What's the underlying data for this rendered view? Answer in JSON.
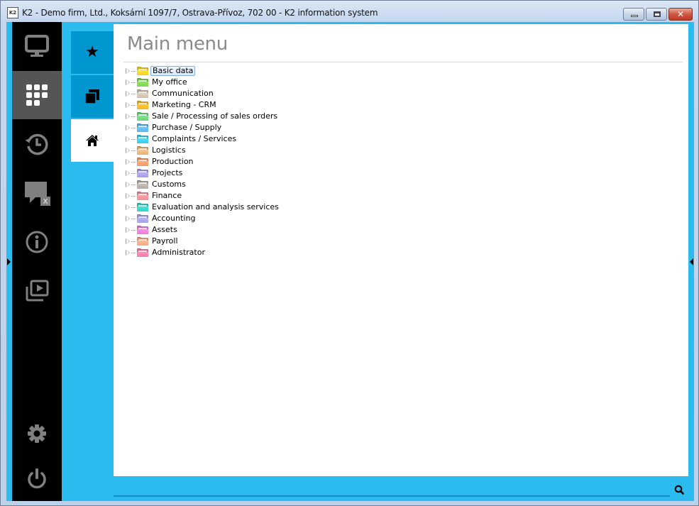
{
  "window": {
    "title": "K2 - Demo firm, Ltd., Koksární 1097/7, Ostrava-Přívoz, 702 00 - K2 information system",
    "app_icon_text": "K2",
    "controls": {
      "minimize": "minimize",
      "maximize": "maximize",
      "close": "✕"
    }
  },
  "left_bar": {
    "items": [
      {
        "name": "desktop",
        "icon": "monitor-icon",
        "active": false
      },
      {
        "name": "main-menu",
        "icon": "grid-icon",
        "active": true
      },
      {
        "name": "history",
        "icon": "history-icon",
        "active": false
      },
      {
        "name": "messages",
        "icon": "chat-icon",
        "badge": "X",
        "active": false
      },
      {
        "name": "info",
        "icon": "info-icon",
        "active": false
      },
      {
        "name": "media",
        "icon": "video-library-icon",
        "active": false
      },
      {
        "name": "settings",
        "icon": "gear-icon",
        "active": false
      },
      {
        "name": "logout",
        "icon": "power-icon",
        "active": false
      }
    ],
    "chat_badge": "X"
  },
  "tabs": [
    {
      "name": "favorites",
      "icon": "star-icon",
      "glyph": "★",
      "active": false
    },
    {
      "name": "windows",
      "icon": "windows-icon",
      "active": false
    },
    {
      "name": "home",
      "icon": "home-icon",
      "active": true
    }
  ],
  "main": {
    "title": "Main menu",
    "tree": [
      {
        "label": "Basic data",
        "color": "#f2cf2a",
        "selected": true
      },
      {
        "label": "My office",
        "color": "#7fd053",
        "selected": false
      },
      {
        "label": "Communication",
        "color": "#c9bfaa",
        "selected": false
      },
      {
        "label": "Marketing - CRM",
        "color": "#f4b52a",
        "selected": false
      },
      {
        "label": "Sale / Processing of sales orders",
        "color": "#6ed07a",
        "selected": false
      },
      {
        "label": "Purchase / Supply",
        "color": "#5fb3ee",
        "selected": false
      },
      {
        "label": "Complaints / Services",
        "color": "#3fc9e9",
        "selected": false
      },
      {
        "label": "Logistics",
        "color": "#e3b07a",
        "selected": false
      },
      {
        "label": "Production",
        "color": "#f49a6a",
        "selected": false
      },
      {
        "label": "Projects",
        "color": "#a99ae3",
        "selected": false
      },
      {
        "label": "Customs",
        "color": "#b2aca6",
        "selected": false
      },
      {
        "label": "Finance",
        "color": "#ef8f96",
        "selected": false
      },
      {
        "label": "Evaluation and analysis services",
        "color": "#39cfc4",
        "selected": false
      },
      {
        "label": "Accounting",
        "color": "#a3a0e6",
        "selected": false
      },
      {
        "label": "Assets",
        "color": "#e77fd4",
        "selected": false
      },
      {
        "label": "Payroll",
        "color": "#f3a783",
        "selected": false
      },
      {
        "label": "Administrator",
        "color": "#ee7ea9",
        "selected": false
      }
    ]
  },
  "search": {
    "icon": "search-icon",
    "value": ""
  }
}
